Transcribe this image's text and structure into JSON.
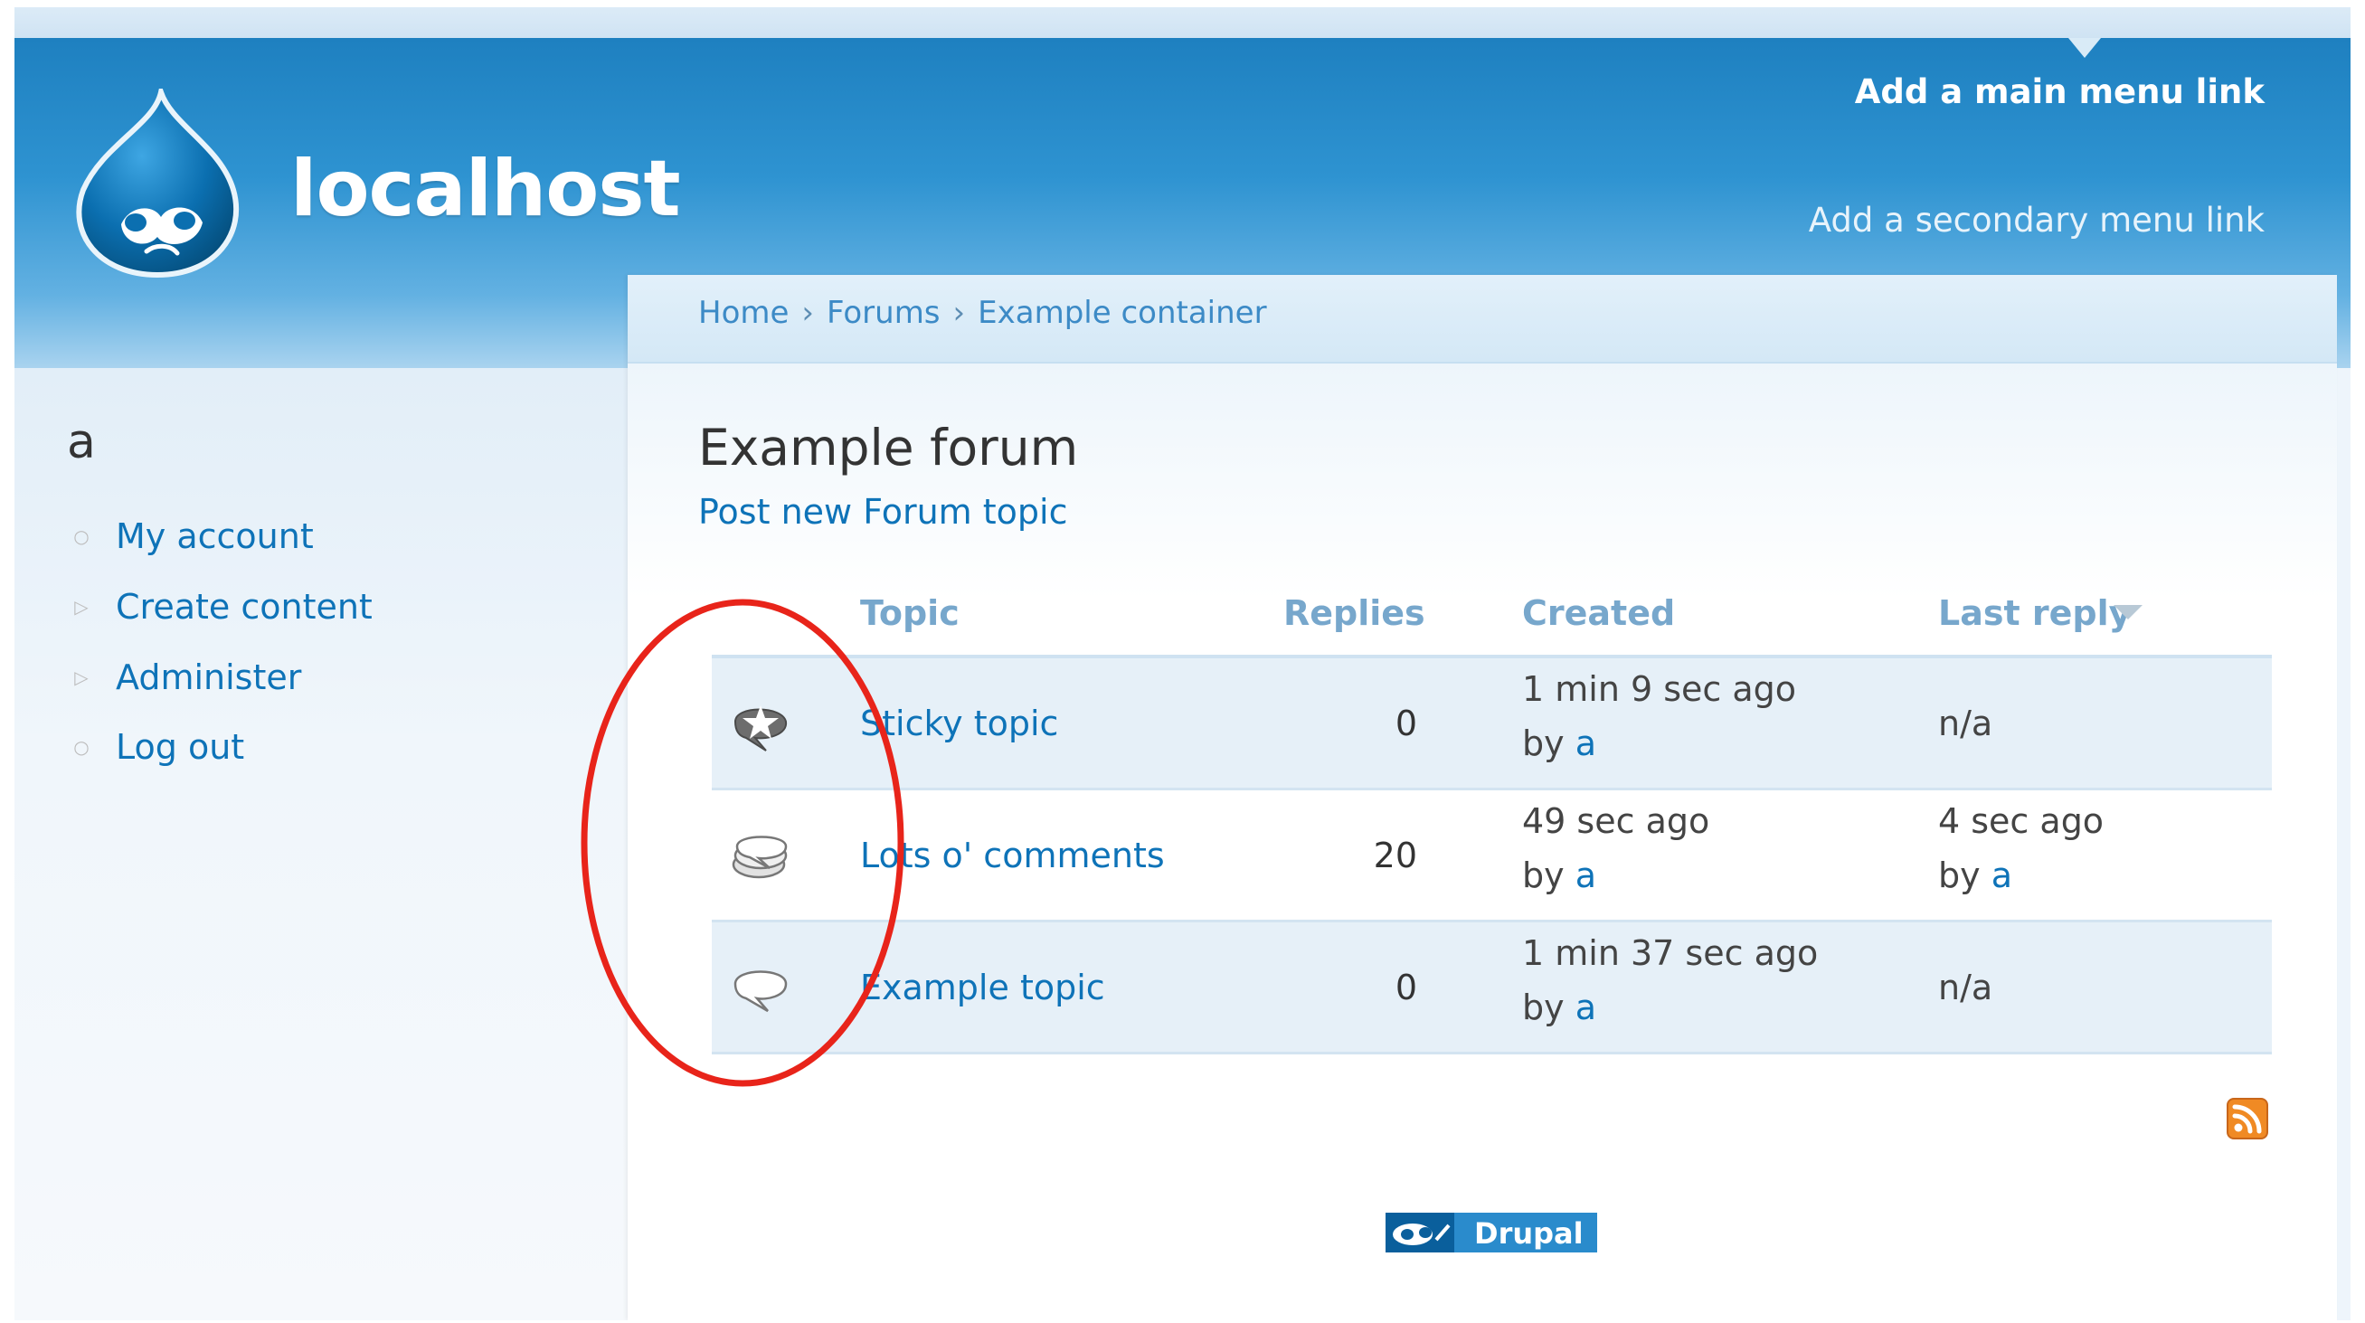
{
  "header": {
    "site_name": "localhost",
    "main_menu_link": "Add a main menu link",
    "secondary_menu_link": "Add a secondary menu link",
    "logo_icon": "drupal-drop-logo-icon"
  },
  "sidebar": {
    "title": "a",
    "items": [
      {
        "label": "My account",
        "bullet": "circle-bullet-icon"
      },
      {
        "label": "Create content",
        "bullet": "triangle-bullet-icon"
      },
      {
        "label": "Administer",
        "bullet": "triangle-bullet-icon"
      },
      {
        "label": "Log out",
        "bullet": "circle-bullet-icon"
      }
    ]
  },
  "breadcrumb": {
    "items": [
      "Home",
      "Forums",
      "Example container"
    ],
    "separator": "›"
  },
  "main": {
    "page_title": "Example forum",
    "post_new_link": "Post new Forum topic"
  },
  "forum_table": {
    "columns": [
      "Topic",
      "Replies",
      "Created",
      "Last reply"
    ],
    "sorted_column": "Last reply",
    "rows": [
      {
        "icon": "sticky-topic-icon",
        "topic": "Sticky topic",
        "replies": "0",
        "created": "1 min 9 sec ago",
        "created_by_prefix": "by",
        "created_by": "a",
        "last_reply": "n/a"
      },
      {
        "icon": "hot-topic-icon",
        "topic": "Lots o' comments",
        "replies": "20",
        "created": "49 sec ago",
        "created_by_prefix": "by",
        "created_by": "a",
        "last_reply": "4 sec ago",
        "last_reply_by_prefix": "by",
        "last_reply_by": "a"
      },
      {
        "icon": "default-topic-icon",
        "topic": "Example topic",
        "replies": "0",
        "created": "1 min 37 sec ago",
        "created_by_prefix": "by",
        "created_by": "a",
        "last_reply": "n/a"
      }
    ]
  },
  "footer": {
    "feed_icon": "rss-feed-icon",
    "badge_label": "Drupal"
  },
  "colors": {
    "header_blue": "#2e93d1",
    "link_blue": "#0e73b8",
    "annotation_red": "#e8241a",
    "rss_orange": "#f08a24"
  }
}
